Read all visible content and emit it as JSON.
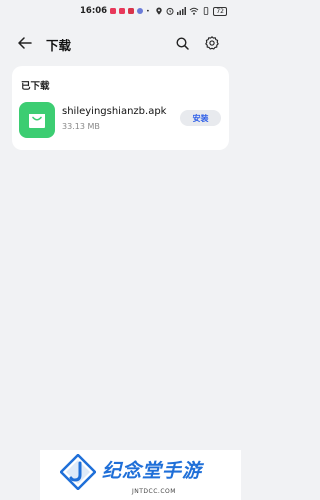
{
  "status_bar": {
    "time": "16:06",
    "battery": "72"
  },
  "header": {
    "title": "下载",
    "icons": [
      "back-arrow-icon",
      "search-icon",
      "gear-icon"
    ]
  },
  "downloaded_section": {
    "label": "已下载",
    "items": [
      {
        "file_name": "shileyingshianzb.apk",
        "size": "33.13 MB",
        "action_label": "安装",
        "icon": "shopping-bag-icon",
        "icon_color": "#3ccd72"
      }
    ]
  },
  "watermark": {
    "text": "纪念堂手游",
    "sub": "JNTDCC.COM"
  },
  "colors": {
    "background": "#f1f2f4",
    "card": "#ffffff",
    "accent": "#2d5ee8"
  }
}
